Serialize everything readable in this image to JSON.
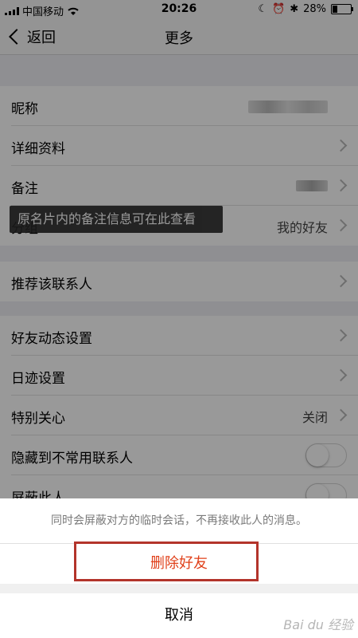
{
  "status_bar": {
    "carrier": "中国移动",
    "time": "20:26",
    "battery": "28%",
    "battery_fraction": 0.28
  },
  "nav": {
    "back_label": "返回",
    "title": "更多"
  },
  "rows": {
    "nickname": {
      "label": "昵称"
    },
    "details": {
      "label": "详细资料"
    },
    "remark": {
      "label": "备注"
    },
    "group": {
      "label": "分组",
      "value": "我的好友"
    },
    "recommend": {
      "label": "推荐该联系人"
    },
    "moments": {
      "label": "好友动态设置"
    },
    "footprint": {
      "label": "日迹设置"
    },
    "special_care": {
      "label": "特别关心",
      "value": "关闭"
    },
    "hide_uncommon": {
      "label": "隐藏到不常用联系人"
    },
    "block": {
      "label": "屏蔽此人"
    }
  },
  "tooltip": "原名片内的备注信息可在此查看",
  "action_sheet": {
    "message": "同时会屏蔽对方的临时会话，不再接收此人的消息。",
    "delete_label": "删除好友",
    "cancel_label": "取消",
    "delete_color": "#e0401a",
    "highlight_color": "#b3342b"
  },
  "watermark": "Bai du 经验"
}
